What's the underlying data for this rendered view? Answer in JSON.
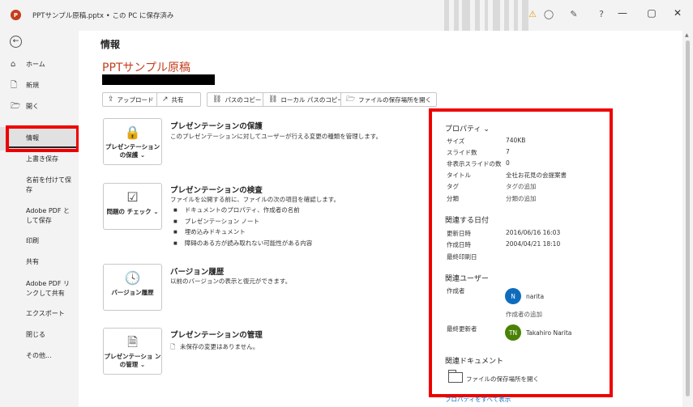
{
  "titlebar": {
    "logo": "P",
    "title": "PPTサンプル原稿.pptx • この PC に保存済み",
    "icons": [
      "warning-icon",
      "person-icon",
      "pen-icon",
      "help-icon"
    ],
    "controls": {
      "minimize": "—",
      "maximize": "▢",
      "close": "✕"
    }
  },
  "nav": {
    "back_icon": "←",
    "items": [
      {
        "label": "ホーム",
        "icon": "⌂"
      },
      {
        "label": "新規",
        "icon": "🗋"
      },
      {
        "label": "開く",
        "icon": "🗁"
      },
      {
        "label": "情報"
      },
      {
        "label": "上書き保存"
      },
      {
        "label": "名前を付けて保存"
      },
      {
        "label": "Adobe PDF として保存"
      },
      {
        "label": "印刷"
      },
      {
        "label": "共有"
      },
      {
        "label": "Adobe PDF リンクして共有"
      },
      {
        "label": "エクスポート"
      },
      {
        "label": "閉じる"
      },
      {
        "label": "その他..."
      }
    ]
  },
  "main": {
    "page_title": "情報",
    "doc_title": "PPTサンプル原稿",
    "toolbar": [
      {
        "label": "アップロード",
        "icon": "⇪"
      },
      {
        "label": "共有",
        "icon": "↗"
      },
      {
        "label": "パスのコピー",
        "icon": "⛓"
      },
      {
        "label": "ローカル パスのコピー",
        "icon": "⛓"
      },
      {
        "label": "ファイルの保存場所を開く",
        "icon": "🗁"
      }
    ],
    "sections": {
      "protect": {
        "button": "プレゼンテーション の保護 ⌄",
        "title": "プレゼンテーションの保護",
        "desc": "このプレゼンテーションに対してユーザーが行える変更の種類を管理します。"
      },
      "inspect": {
        "button": "問題の チェック ⌄",
        "title": "プレゼンテーションの検査",
        "desc": "ファイルを公開する前に、ファイルの次の項目を確認します。",
        "bullets": [
          "ドキュメントのプロパティ、作成者の名前",
          "プレゼンテーション ノート",
          "埋め込みドキュメント",
          "障碍のある方が読み取れない可能性がある内容"
        ]
      },
      "versions": {
        "button": "バージョン履歴",
        "title": "バージョン履歴",
        "desc": "以前のバージョンの表示と復元ができます。"
      },
      "manage": {
        "button": "プレゼンテーショ ンの管理 ⌄",
        "title": "プレゼンテーションの管理",
        "desc": "未保存の変更はありません。"
      }
    }
  },
  "properties": {
    "heading": "プロパティ ⌄",
    "rows": [
      {
        "key": "サイズ",
        "value": "740KB"
      },
      {
        "key": "スライド数",
        "value": "7"
      },
      {
        "key": "非表示スライドの数",
        "value": "0"
      },
      {
        "key": "タイトル",
        "value": "全社お花見の会提案書"
      },
      {
        "key": "タグ",
        "value": "タグの追加"
      },
      {
        "key": "分類",
        "value": "分類の追加"
      }
    ],
    "dates_heading": "関連する日付",
    "dates": [
      {
        "key": "更新日時",
        "value": "2016/06/16 16:03"
      },
      {
        "key": "作成日時",
        "value": "2004/04/21 18:10"
      },
      {
        "key": "最終印刷日",
        "value": ""
      }
    ],
    "users_heading": "関連ユーザー",
    "author_label": "作成者",
    "author_initial": "N",
    "author_name": "narita",
    "author_add": "作成者の追加",
    "modifier_label": "最終更新者",
    "modifier_initial": "TN",
    "modifier_name": "Takahiro Narita",
    "docs_heading": "関連ドキュメント",
    "open_location": "ファイルの保存場所を開く",
    "show_all": "プロパティをすべて表示"
  },
  "colors": {
    "accent": "#c43e1c",
    "highlight": "#ee0000",
    "author_avatar": "#0f6cbd",
    "modifier_avatar": "#498205"
  }
}
